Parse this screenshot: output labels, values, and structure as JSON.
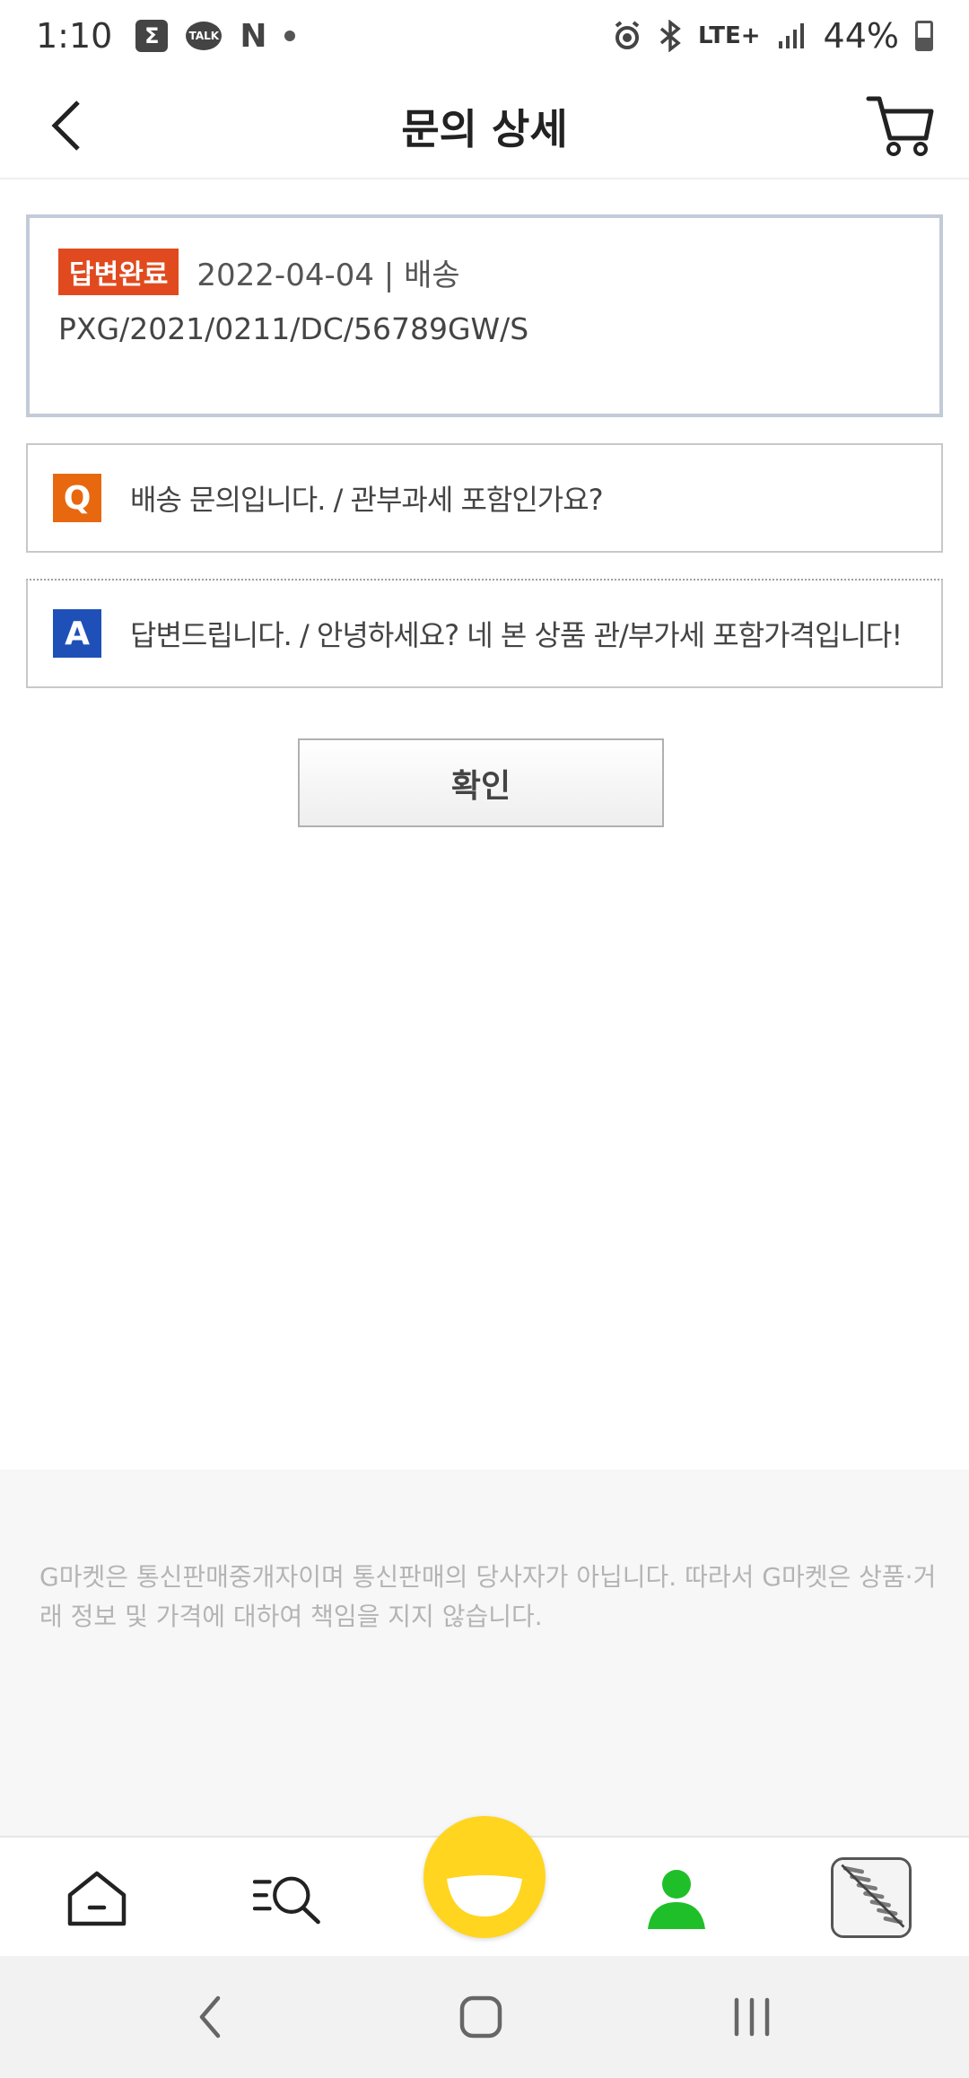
{
  "status_bar": {
    "time": "1:10",
    "notif_badge": "Σ",
    "talk_label": "TALK",
    "netflix_label": "N",
    "network": "LTE+",
    "battery": "44%"
  },
  "header": {
    "title": "문의 상세"
  },
  "inquiry": {
    "status": "답변완료",
    "date_category": "2022-04-04 | 배송",
    "product_code": "PXG/2021/0211/DC/56789GW/S"
  },
  "question": {
    "icon_label": "Q",
    "text": "배송 문의입니다. / 관부과세 포함인가요?"
  },
  "answer": {
    "icon_label": "A",
    "text": "답변드립니다. / 안녕하세요? 네 본 상품 관/부가세 포함가격입니다!"
  },
  "confirm_button": {
    "label": "확인"
  },
  "footer": {
    "notice": "G마켓은 통신판매중개자이며 통신판매의 당사자가 아닙니다. 따라서 G마켓은 상품·거래 정보 및 가격에 대하여 책임을 지지 않습니다."
  },
  "colors": {
    "status_badge": "#e14a1e",
    "q_icon": "#e8680f",
    "a_icon": "#1e50b8",
    "center_tab": "#ffd51f",
    "my_tab": "#1fbf2a"
  },
  "tab_bar": {
    "icons": [
      "home-icon",
      "category-search-icon",
      "gmarket-smile-icon",
      "my-page-icon",
      "recent-item-thumbnail"
    ]
  }
}
